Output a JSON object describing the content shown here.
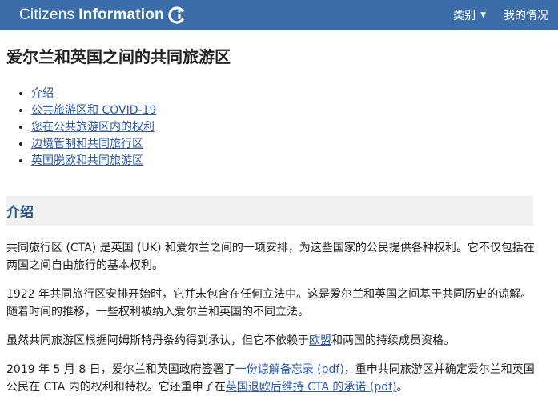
{
  "header": {
    "brand_light": "Citizens",
    "brand_bold": "Information",
    "nav": [
      {
        "label": "类别"
      },
      {
        "label": "我的情况"
      }
    ]
  },
  "page": {
    "title": "爱尔兰和英国之间的共同旅游区",
    "toc": [
      "介绍",
      "公共旅游区和 COVID-19",
      "您在公共旅游区内的权利",
      "边境管制和共同旅行区",
      "英国脱欧和共同旅游区"
    ],
    "section_title": "介绍",
    "p1": "共同旅行区 (CTA) 是英国 (UK) 和爱尔兰之间的一项安排，为这些国家的公民提供各种权利。它不仅包括在两国之间自由旅行的基本权利。",
    "p2": "1922 年共同旅行区安排开始时，它并未包含在任何立法中。这是爱尔兰和英国之间基于共同历史的谅解。随着时间的推移，一些权利被纳入爱尔兰和英国的不同立法。",
    "p3_before": "虽然共同旅游区根据阿姆斯特丹条约得到承认，但它不依赖于",
    "p3_link": "欧盟",
    "p3_after": "和两国的持续成员资格。",
    "p4_before": "2019 年 5 月 8 日，爱尔兰和英国政府签署了",
    "p4_link1": "一份谅解备忘录 (pdf)",
    "p4_mid": "，重申共同旅游区并确定爱尔兰和英国公民在 CTA 内的权利和特权。它还重申了在",
    "p4_link2": "英国退欧后维持 CTA 的承诺 (pdf)",
    "p4_after": "。"
  }
}
